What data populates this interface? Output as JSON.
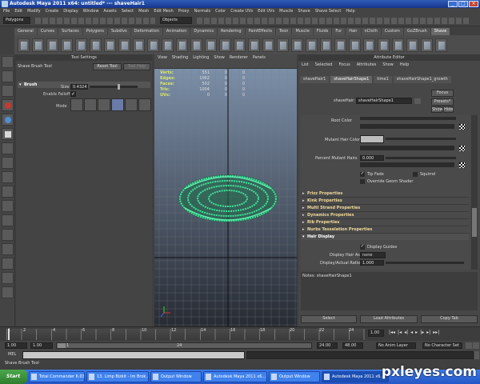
{
  "window": {
    "title": "Autodesk Maya 2011 x64: untitled*  ---  shaveHair1"
  },
  "menubar": [
    "File",
    "Edit",
    "Modify",
    "Create",
    "Display",
    "Window",
    "Assets",
    "Select",
    "Mesh",
    "Edit Mesh",
    "Proxy",
    "Normals",
    "Color",
    "Create UVs",
    "Edit UVs",
    "Muscle",
    "Shave",
    "Shave Select",
    "Help"
  ],
  "statusline": {
    "mode": "Polygons",
    "objects_label": "Objects"
  },
  "shelf": {
    "tabs": [
      "General",
      "Curves",
      "Surfaces",
      "Polygons",
      "Subdivs",
      "Deformation",
      "Animation",
      "Dynamics",
      "Rendering",
      "PaintEffects",
      "Toon",
      "Muscle",
      "Fluids",
      "Fur",
      "Hair",
      "nCloth",
      "Custom",
      "GoZBrush",
      "Shave"
    ],
    "active_tab": "Shave"
  },
  "tool_settings": {
    "title": "Tool Settings",
    "tool_name": "Shave Brush Tool",
    "reset_label": "Reset Tool",
    "help_label": "Tool Help",
    "section": "Brush",
    "size_label": "Size",
    "size_value": "0.4324",
    "falloff_label": "Enable Falloff",
    "falloff_checked": true,
    "mode_label": "Mode"
  },
  "viewport": {
    "menu": [
      "View",
      "Shading",
      "Lighting",
      "Show",
      "Renderer",
      "Panels"
    ],
    "hud": [
      {
        "label": "Verts:",
        "v1": "551",
        "v2": "0",
        "v3": "0"
      },
      {
        "label": "Edges:",
        "v1": "1062",
        "v2": "0",
        "v3": "0"
      },
      {
        "label": "Faces:",
        "v1": "502",
        "v2": "0",
        "v3": "0"
      },
      {
        "label": "Tris:",
        "v1": "1004",
        "v2": "0",
        "v3": "0"
      },
      {
        "label": "UVs:",
        "v1": "0",
        "v2": "0",
        "v3": "0"
      }
    ]
  },
  "attribute_editor": {
    "title": "Attribute Editor",
    "menu": [
      "List",
      "Selected",
      "Focus",
      "Attributes",
      "Show",
      "Help"
    ],
    "tabs": [
      "shaveHair1",
      "shaveHairShape1",
      "time1",
      "shaveHairShape1_growth"
    ],
    "active_tab": "shaveHairShape1",
    "node_label": "shaveHair:",
    "node_value": "shaveHairShape1",
    "focus_label": "Focus",
    "presets_label": "Presets*",
    "show_label": "Show",
    "hide_label": "Hide",
    "root_color_label": "Root Color",
    "mutant_color_label": "Mutant Hair Color",
    "percent_mutant_label": "Percent Mutant Hairs",
    "percent_mutant_value": "0.000",
    "tip_fade_label": "Tip Fade",
    "squirrel_label": "Squirrel",
    "override_label": "Override Geom Shader",
    "sections": [
      "Frizz Properties",
      "Kink Properties",
      "Multi Strand Properties",
      "Dynamics Properties",
      "Rib Properties",
      "Nurbs Tesselation Properties"
    ],
    "hair_display": "Hair Display",
    "display_guides_label": "Display Guides",
    "display_hair_as_label": "Display Hair As",
    "display_hair_as_value": "none",
    "display_ratio_label": "Display/Actual Ratio",
    "display_ratio_value": "1.000",
    "notes_label": "Notes:  shaveHairShape1",
    "select_label": "Select",
    "load_attrs_label": "Load Attributes",
    "copy_tab_label": "Copy Tab"
  },
  "timeline": {
    "ticks": [
      "1",
      "2",
      "4",
      "6",
      "8",
      "10",
      "12",
      "14",
      "16",
      "18",
      "20",
      "22",
      "24"
    ],
    "current_frame": "1.00"
  },
  "range": {
    "start": "1.00",
    "start2": "1.00",
    "field1": "1",
    "field2": "24",
    "end": "24.00",
    "end2": "48.00",
    "anim_layer": "No Anim Layer",
    "char_set": "No Character Set"
  },
  "mel": {
    "label": "MEL"
  },
  "helpline": {
    "text": "Shave Brush Tool"
  },
  "taskbar": {
    "start_label": "Start",
    "tasks": [
      "Total Commander 6.03 -...",
      "13. Limp Bizkit - Im Brok...",
      "Output Window",
      "Autodesk Maya 2011 x6...",
      "Output Window",
      "Autodesk Maya 2011 x6..."
    ],
    "active_task": 5
  },
  "watermark": "pxleyes.com",
  "colors": {
    "hair": "#3fe29a",
    "grid": "#6a6a6a",
    "hud_label": "#dbe86a"
  }
}
